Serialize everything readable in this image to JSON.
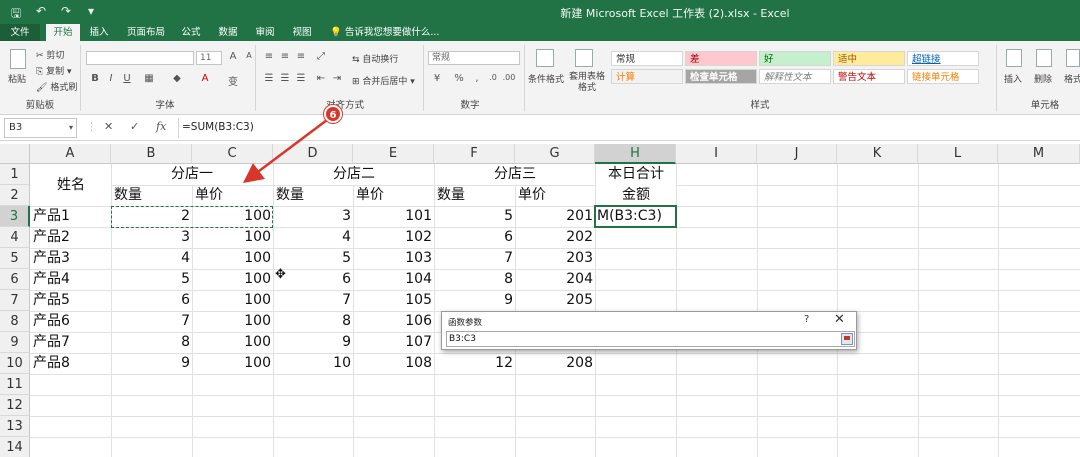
{
  "window": {
    "title": "新建 Microsoft Excel 工作表 (2).xlsx - Excel"
  },
  "ribbon": {
    "tabs": [
      "文件",
      "开始",
      "插入",
      "页面布局",
      "公式",
      "数据",
      "审阅",
      "视图"
    ],
    "active_tab": "开始",
    "tell_me": "告诉我您想要做什么...",
    "clipboard": {
      "paste": "粘贴",
      "cut": "剪切",
      "copy": "复制",
      "format_painter": "格式刷",
      "label": "剪贴板"
    },
    "font": {
      "font_name": "",
      "font_size": "11",
      "label": "字体"
    },
    "alignment": {
      "wrap": "自动换行",
      "merge": "合并后居中",
      "label": "对齐方式"
    },
    "number": {
      "format": "常规",
      "label": "数字"
    },
    "styles": {
      "conditional": "条件格式",
      "table": "套用表格格式",
      "cells": [
        "常规",
        "差",
        "好",
        "适中",
        "超链接",
        "计算",
        "检查单元格",
        "解释性文本",
        "警告文本",
        "链接单元格"
      ],
      "label": "样式"
    },
    "cells": {
      "insert": "插入",
      "delete": "删除",
      "format": "格式",
      "label": "单元格"
    }
  },
  "formula_bar": {
    "name_box": "B3",
    "formula": "=SUM(B3:C3)"
  },
  "grid": {
    "columns": [
      "A",
      "B",
      "C",
      "D",
      "E",
      "F",
      "G",
      "H",
      "I",
      "J",
      "K",
      "L",
      "M"
    ],
    "rows": [
      "1",
      "2",
      "3",
      "4",
      "5",
      "6",
      "7",
      "8",
      "9",
      "10",
      "11",
      "12",
      "13",
      "14"
    ],
    "header_row1": {
      "name": "姓名",
      "store1": "分店一",
      "store2": "分店二",
      "store3": "分店三",
      "total": "本日合计"
    },
    "header_row2": {
      "qty1": "数量",
      "price1": "单价",
      "qty2": "数量",
      "price2": "单价",
      "qty3": "数量",
      "price3": "单价",
      "amount": "金额"
    },
    "products": [
      {
        "name": "产品1",
        "b": "2",
        "c": "100",
        "d": "3",
        "e": "101",
        "f": "5",
        "g": "201"
      },
      {
        "name": "产品2",
        "b": "3",
        "c": "100",
        "d": "4",
        "e": "102",
        "f": "6",
        "g": "202"
      },
      {
        "name": "产品3",
        "b": "4",
        "c": "100",
        "d": "5",
        "e": "103",
        "f": "7",
        "g": "203"
      },
      {
        "name": "产品4",
        "b": "5",
        "c": "100",
        "d": "6",
        "e": "104",
        "f": "8",
        "g": "204"
      },
      {
        "name": "产品5",
        "b": "6",
        "c": "100",
        "d": "7",
        "e": "105",
        "f": "9",
        "g": "205"
      },
      {
        "name": "产品6",
        "b": "7",
        "c": "100",
        "d": "8",
        "e": "106",
        "f": "",
        "g": ""
      },
      {
        "name": "产品7",
        "b": "8",
        "c": "100",
        "d": "9",
        "e": "107",
        "f": "",
        "g": ""
      },
      {
        "name": "产品8",
        "b": "9",
        "c": "100",
        "d": "10",
        "e": "108",
        "f": "12",
        "g": "208"
      }
    ],
    "h3_text": "M(B3:C3)"
  },
  "dialog": {
    "title": "函数参数",
    "help": "?",
    "close": "✕",
    "input_value": "B3:C3"
  },
  "annotation": {
    "step": "6"
  },
  "colors": {
    "excel_green": "#217346",
    "annotation_red": "#d9362b"
  }
}
